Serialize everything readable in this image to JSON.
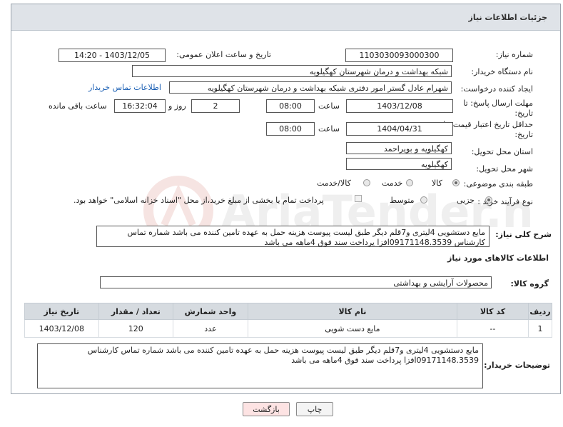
{
  "header": {
    "title": "جزئیات اطلاعات نیاز"
  },
  "fields": {
    "need_number_label": "شماره نیاز:",
    "need_number": "1103030093000300",
    "announce_label": "تاریخ و ساعت اعلان عمومی:",
    "announce_value": "1403/12/05 - 14:20",
    "buyer_org_label": "نام دستگاه خریدار:",
    "buyer_org": "شبکه بهداشت و درمان شهرستان کهگیلویه",
    "requester_label": "ایجاد کننده درخواست:",
    "requester": "شهرام عادل گستر امور دفتری شبکه بهداشت و درمان شهرستان کهگیلویه",
    "contact_link": "اطلاعات تماس خریدار",
    "deadline_label_1": "مهلت ارسال پاسخ: تا",
    "deadline_label_2": "تاریخ:",
    "deadline_date": "1403/12/08",
    "time_label": "ساعت",
    "deadline_time": "08:00",
    "days_value": "2",
    "days_label": "روز و",
    "remaining_time": "16:32:04",
    "remaining_label": "ساعت باقی مانده",
    "validity_label_1": "حداقل تاریخ اعتبار قیمت: تا",
    "validity_label_2": "تاریخ:",
    "validity_date": "1404/04/31",
    "validity_time_label": "ساعت",
    "validity_time": "08:00",
    "province_label": "استان محل تحویل:",
    "province": "کهگیلویه و بویراحمد",
    "city_label": "شهر محل تحویل:",
    "city": "کهگیلویه",
    "category_label": "طبقه بندی موضوعی:",
    "category_options": [
      "کالا",
      "خدمت",
      "کالا/خدمت"
    ],
    "process_label": "نوع فرآیند خرید :",
    "process_options": [
      "جزیی",
      "متوسط"
    ],
    "payment_note": "پرداخت تمام یا بخشی از مبلغ خرید،از محل \"اسناد خزانه اسلامی\" خواهد بود.",
    "description_label": "شرح کلی نیاز:",
    "description": "مایع دستشویی 4لیتری و7قلم دیگر طبق لیست پیوست هزینه حمل به عهده تامین کننده می باشد شماره تماس کارشناس 09171148.3539افزا پرداخت سند فوق 4ماهه می باشد",
    "goods_info_title": "اطلاعات کالاهای مورد نیاز",
    "goods_group_label": "گروه کالا:",
    "goods_group": "محصولات آرایشی و بهداشتی",
    "buyer_notes_label": "توضیحات خریدار:",
    "buyer_notes": "مایع دستشویی 4لیتری و7قلم دیگر طبق لیست پیوست هزینه حمل به عهده تامین کننده می باشد شماره تماس کارشناس 09171148.3539افزا پرداخت سند فوق 4ماهه می باشد"
  },
  "table": {
    "headers": [
      "ردیف",
      "کد کالا",
      "نام کالا",
      "واحد شمارش",
      "تعداد / مقدار",
      "تاریخ نیاز"
    ],
    "rows": [
      [
        "1",
        "--",
        "مایع دست شویی",
        "عدد",
        "120",
        "1403/12/08"
      ]
    ]
  },
  "buttons": {
    "print": "چاپ",
    "back": "بازگشت"
  },
  "watermark_text": "AriaTender.net"
}
